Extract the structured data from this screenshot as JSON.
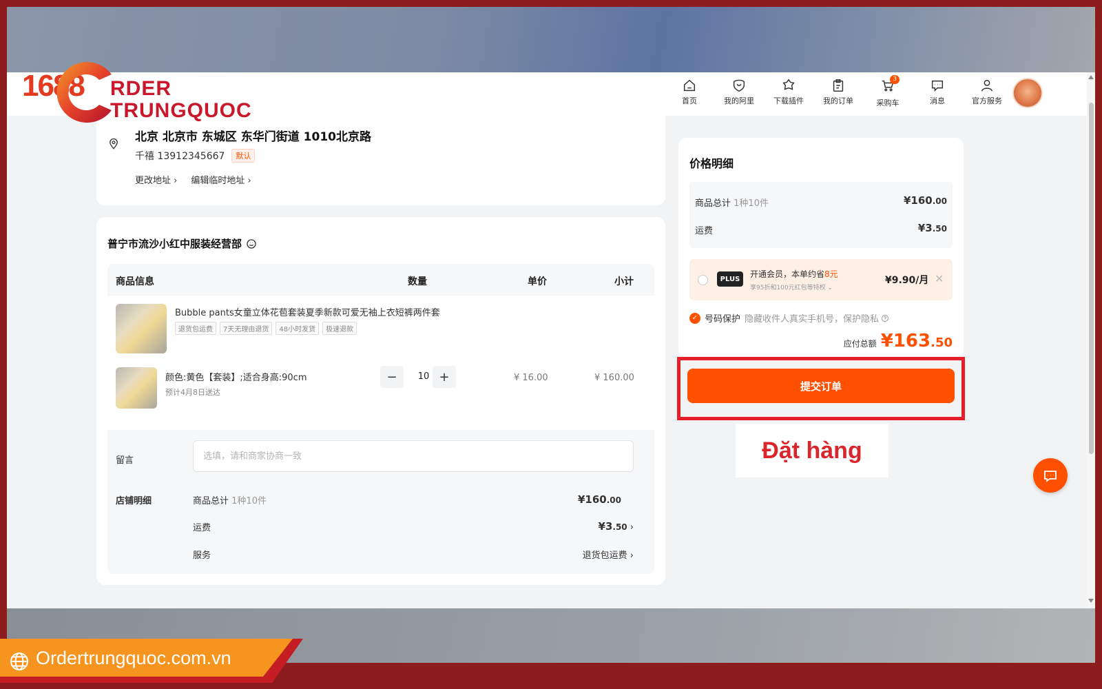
{
  "nav": {
    "items": [
      {
        "label": "首页",
        "icon": "home-icon"
      },
      {
        "label": "我的阿里",
        "icon": "heart-shield-icon"
      },
      {
        "label": "下载插件",
        "icon": "puzzle-icon"
      },
      {
        "label": "我的订单",
        "icon": "clipboard-icon"
      },
      {
        "label": "采购车",
        "icon": "cart-icon",
        "badge": "3"
      },
      {
        "label": "消息",
        "icon": "message-icon"
      },
      {
        "label": "官方服务",
        "icon": "user-icon"
      }
    ]
  },
  "address": {
    "line": "北京 北京市 东城区 东华门街道 1010北京路",
    "person": "千禧 13912345667",
    "default_tag": "默认",
    "change_link": "更改地址",
    "edit_link": "编辑临时地址"
  },
  "shop": {
    "name": "普宁市流沙小红中服装经营部",
    "headers": {
      "info": "商品信息",
      "qty": "数量",
      "unit": "单价",
      "subtotal": "小计"
    },
    "product": {
      "title": "Bubble pants女童立体花苞套装夏季新款可爱无袖上衣短裤两件套",
      "tags": [
        "退货包运费",
        "7天无理由退货",
        "48小时发货",
        "极速退款"
      ],
      "sku": "颜色:黄色【套装】;适合身高:90cm",
      "eta": "预计4月8日送达",
      "qty": "10",
      "unit_price": "¥ 16.00",
      "subtotal": "¥ 160.00"
    },
    "message_label": "留言",
    "message_placeholder": "选填，请和商家协商一致",
    "detail_label": "店铺明细",
    "detail": {
      "goods_label": "商品总计",
      "goods_count": "1种10件",
      "goods_amount": "¥160",
      "goods_cents": ".00",
      "shipping_label": "运费",
      "shipping_amount": "¥3",
      "shipping_cents": ".50",
      "service_label": "服务",
      "service_value": "退货包运费"
    }
  },
  "price": {
    "title": "价格明细",
    "goods_label": "商品总计",
    "goods_count": "1种10件",
    "goods_amount": "¥160",
    "goods_cents": ".00",
    "shipping_label": "运费",
    "shipping_amount": "¥3",
    "shipping_cents": ".50",
    "plus_badge": "PLUS",
    "plus_main_prefix": "开通会员，本单约省",
    "plus_main_highlight": "8元",
    "plus_sub": "享95折和100元红包等特权",
    "plus_price": "¥9.90/月",
    "privacy_label": "号码保护",
    "privacy_desc": "隐藏收件人真实手机号，保护隐私",
    "total_label": "应付总额",
    "total_amount": "¥163",
    "total_cents": ".50",
    "submit": "提交订单"
  },
  "callout": "Đặt hàng",
  "logo": {
    "number": "1688",
    "line1": "RDER",
    "line2": "TRUNGQUOC"
  },
  "footer": {
    "site": "Ordertrungquoc.com.vn"
  },
  "colors": {
    "accent": "#ff5000",
    "highlight_red": "#e61e28",
    "frame": "#8c1c1e"
  }
}
